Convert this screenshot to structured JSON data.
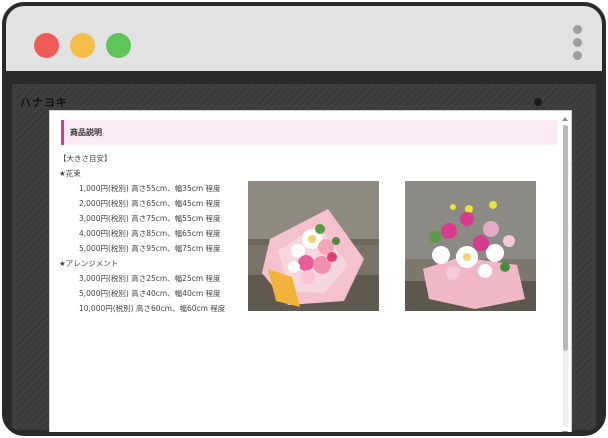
{
  "window": {
    "buttons": [
      "close",
      "minimize",
      "maximize"
    ],
    "menu_icon": "more-vertical-icon"
  },
  "site": {
    "logo": "ハナヨキ"
  },
  "modal": {
    "section_title": "商品説明",
    "size_heading": "【大きさ目安】",
    "bouquet": {
      "heading": "★花束",
      "items": [
        "1,000円(税別)  高さ55cm、幅35cm 程度",
        "2,000円(税別)  高さ65cm、幅45cm 程度",
        "3,000円(税別)  高さ75cm、幅55cm 程度",
        "4,000円(税別)  高さ85cm、幅65cm 程度",
        "5,000円(税別)  高さ95cm、幅75cm 程度"
      ]
    },
    "arrangement": {
      "heading": "★アレンジメント",
      "items": [
        "3,000円(税別)  高さ25cm、幅25cm 程度",
        "5,000円(税別)  高さ40cm、幅40cm 程度",
        "10,000円(税別)  高さ60cm、幅60cm 程度"
      ]
    },
    "images": [
      {
        "subject": "bouquet-photo"
      },
      {
        "subject": "arrangement-photo"
      }
    ]
  },
  "colors": {
    "accent": "#d8388e",
    "section_bg": "#fbeaf5",
    "close": "#ee5a55",
    "minimize": "#f5bd4a",
    "maximize": "#5fc45a"
  }
}
